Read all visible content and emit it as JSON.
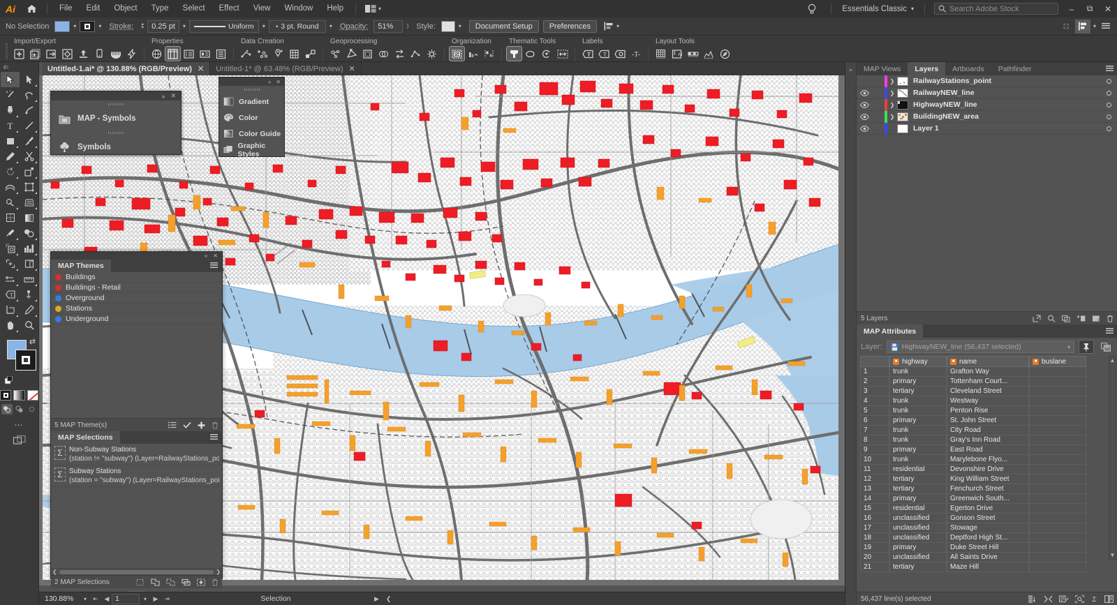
{
  "app": {
    "name": "Adobe Illustrator",
    "logo_text": "Ai",
    "workspace": "Essentials Classic",
    "stock_placeholder": "Search Adobe Stock"
  },
  "menubar": {
    "items": [
      "File",
      "Edit",
      "Object",
      "Type",
      "Select",
      "Effect",
      "View",
      "Window",
      "Help"
    ],
    "home_icon": "home-icon",
    "arrange_icon": "arrange-documents-icon",
    "bulb_icon": "lightbulb-icon",
    "search_icon": "search-icon",
    "window_controls": [
      "minimize",
      "restore",
      "close"
    ]
  },
  "controlbar": {
    "selection_status": "No Selection",
    "fill_label": "fill-swatch",
    "stroke_swatch_label": "stroke-swatch",
    "stroke_label": "Stroke:",
    "stroke_weight": "0.25 pt",
    "profile_label": "Uniform",
    "brush_label": "3 pt. Round",
    "opacity_label": "Opacity:",
    "opacity_value": "51%",
    "style_label": "Style:",
    "document_setup": "Document Setup",
    "preferences": "Preferences",
    "align_icon": "align-icon"
  },
  "maptoolbar": {
    "groups": [
      {
        "title": "Import/Export",
        "icons": [
          "import-icon",
          "import-multiple-icon",
          "export-icon",
          "simple-import-icon",
          "upload-icon",
          "device-icon",
          "web-author-icon",
          "quick-import-icon"
        ]
      },
      {
        "title": "Properties",
        "icons": [
          "map-view-editor-icon",
          "map-attributes-icon",
          "attribute-schema-icon",
          "map-tags-icon",
          "data-list-icon"
        ]
      },
      {
        "title": "Data Creation",
        "icons": [
          "create-line-icon",
          "create-points-icon",
          "create-point-icon",
          "grid-table-icon",
          "join-icon"
        ]
      },
      {
        "title": "Geoprocessing",
        "icons": [
          "dissolve-icon",
          "buffer-icon",
          "clip-icon",
          "spatial-icon",
          "transform-icon",
          "node-editor-icon",
          "settings-icon"
        ]
      },
      {
        "title": "Organization",
        "icons": [
          "map-area-icon",
          "legend-icon",
          "align-layers-icon"
        ]
      },
      {
        "title": "Thematic Tools",
        "icons": [
          "stylesheet-icon",
          "dot-density-icon",
          "scale-bar-theme-icon",
          "range-icon"
        ]
      },
      {
        "title": "Labels",
        "icons": [
          "label-pro-icon",
          "label-icon",
          "label-settings-icon",
          "text-tool-icon"
        ]
      },
      {
        "title": "Layout Tools",
        "icons": [
          "grid-graticule-icon",
          "artboard-icon",
          "scale-bar-icon",
          "elevation-icon",
          "north-arrow-icon"
        ]
      }
    ]
  },
  "tabs": [
    {
      "label": "Untitled-1.ai* @ 130.88% (RGB/Preview)",
      "active": true
    },
    {
      "label": "Untitled-1* @ 63.48% (RGB/Preview)",
      "active": false
    }
  ],
  "toolbox": {
    "tools": [
      [
        "selection-tool",
        "direct-selection-tool"
      ],
      [
        "magic-wand-tool",
        "lasso-tool"
      ],
      [
        "pen-tool",
        "curvature-tool"
      ],
      [
        "type-tool",
        "line-segment-tool"
      ],
      [
        "rectangle-tool",
        "paintbrush-tool"
      ],
      [
        "pencil-tool",
        "scissors-tool"
      ],
      [
        "rotate-tool",
        "scale-tool"
      ],
      [
        "width-tool",
        "free-transform-tool"
      ],
      [
        "shape-builder-tool",
        "perspective-grid-tool"
      ],
      [
        "mesh-tool",
        "gradient-tool"
      ],
      [
        "eyedropper-tool",
        "blend-tool"
      ],
      [
        "symbol-sprayer-tool",
        "column-graph-tool"
      ],
      [
        "artboard-tool",
        "slice-tool"
      ],
      [
        "puppet-warp-tool",
        "measure-tool"
      ],
      [
        "touch-type-tool",
        "anchor-point-tool"
      ],
      [
        "crop-image-tool",
        "pencil-edit-tool"
      ],
      [
        "hand-tool",
        "zoom-tool"
      ]
    ],
    "fill_color": "#8ab4e8",
    "stroke_color": "#1c1c1c",
    "selected_tool": "selection-tool"
  },
  "symbols_panel": {
    "close_icon": "close-icon",
    "expand_icon": "expand-icon",
    "items": [
      {
        "label": "MAP - Symbols",
        "icon": "map-symbols-folder-icon"
      },
      {
        "label": "Symbols",
        "icon": "symbols-clover-icon"
      }
    ]
  },
  "dock_column": {
    "items": [
      {
        "label": "Gradient",
        "icon": "gradient-icon"
      },
      {
        "label": "Color",
        "icon": "color-palette-icon"
      },
      {
        "label": "Color Guide",
        "icon": "color-guide-icon"
      },
      {
        "label": "Graphic Styles",
        "icon": "graphic-styles-icon"
      }
    ]
  },
  "map_themes": {
    "tab_label": "MAP Themes",
    "menu_icon": "panel-menu-icon",
    "items": [
      {
        "label": "Buildings",
        "color": "#e02b2b"
      },
      {
        "label": "Buildings - Retail",
        "color": "#e02b2b"
      },
      {
        "label": "Overground",
        "color": "#2f7fe0"
      },
      {
        "label": "Stations",
        "color": "#e0a81e"
      },
      {
        "label": "Underground",
        "color": "#2f7fe0"
      }
    ],
    "footer_count": "5 MAP Theme(s)",
    "footer_icons": [
      "list-view-icon",
      "apply-theme-icon",
      "new-theme-icon",
      "delete-theme-icon"
    ]
  },
  "map_selections": {
    "tab_label": "MAP Selections",
    "menu_icon": "panel-menu-icon",
    "items": [
      {
        "name": "Non-Subway Stations",
        "expr": "(station != \"subway\") (Layer=RailwayStations_point)"
      },
      {
        "name": "Subway Stations",
        "expr": "(station = \"subway\") (Layer=RailwayStations_point)"
      }
    ],
    "footer_count": "2 MAP Selections",
    "footer_icons": [
      "new-selection-icon",
      "union-icon",
      "subtract-icon",
      "intersect-icon",
      "add-selection-icon",
      "delete-selection-icon"
    ]
  },
  "right_dock": {
    "tabs": [
      {
        "label": "MAP Views",
        "active": false
      },
      {
        "label": "Layers",
        "active": true
      },
      {
        "label": "Artboards",
        "active": false
      },
      {
        "label": "Pathfinder",
        "active": false
      }
    ],
    "menu_icon": "panel-menu-icon",
    "layers": [
      {
        "name": "RailwayStations_point",
        "color": "#ff3ce0",
        "visible": false,
        "has_children": true,
        "thumb": "points-thumb"
      },
      {
        "name": "RailwayNEW_line",
        "color": "#3a49e8",
        "visible": true,
        "has_children": true,
        "thumb": "lines-thumb"
      },
      {
        "name": "HighwayNEW_line",
        "color": "#e8413a",
        "visible": true,
        "has_children": true,
        "thumb": "highway-thumb"
      },
      {
        "name": "BuildingNEW_area",
        "color": "#3ae05a",
        "visible": true,
        "has_children": true,
        "thumb": "buildings-thumb"
      },
      {
        "name": "Layer 1",
        "color": "#3a49e8",
        "visible": true,
        "has_children": false,
        "thumb": "empty-thumb"
      }
    ],
    "layers_footer_count": "5 Layers",
    "layers_footer_icons": [
      "release-icon",
      "locate-icon",
      "make-mask-icon",
      "new-sublayer-icon",
      "new-layer-icon",
      "delete-layer-icon"
    ]
  },
  "map_attributes": {
    "tab_label": "MAP Attributes",
    "menu_icon": "panel-menu-icon",
    "layer_label": "Layer:",
    "layer_value": "HighwayNEW_line (56,437 selected)",
    "layer_icon": "save-layer-icon",
    "pin_icon": "pin-icon",
    "copy_icon": "duplicate-icon",
    "columns": [
      "highway",
      "name",
      "buslane"
    ],
    "rows": [
      {
        "i": "1",
        "highway": "trunk",
        "name": "Grafton Way",
        "buslane": ""
      },
      {
        "i": "2",
        "highway": "primary",
        "name": "Tottenham Court...",
        "buslane": ""
      },
      {
        "i": "3",
        "highway": "tertiary",
        "name": "Cleveland Street",
        "buslane": ""
      },
      {
        "i": "4",
        "highway": "trunk",
        "name": "Westway",
        "buslane": ""
      },
      {
        "i": "5",
        "highway": "trunk",
        "name": "Penton Rise",
        "buslane": ""
      },
      {
        "i": "6",
        "highway": "primary",
        "name": "St. John Street",
        "buslane": ""
      },
      {
        "i": "7",
        "highway": "trunk",
        "name": "City Road",
        "buslane": ""
      },
      {
        "i": "8",
        "highway": "trunk",
        "name": "Gray's Inn Road",
        "buslane": ""
      },
      {
        "i": "9",
        "highway": "primary",
        "name": "East Road",
        "buslane": ""
      },
      {
        "i": "10",
        "highway": "trunk",
        "name": "Marylebone Flyo...",
        "buslane": ""
      },
      {
        "i": "11",
        "highway": "residential",
        "name": "Devonshire Drive",
        "buslane": ""
      },
      {
        "i": "12",
        "highway": "tertiary",
        "name": "King William Street",
        "buslane": ""
      },
      {
        "i": "13",
        "highway": "tertiary",
        "name": "Fenchurch Street",
        "buslane": ""
      },
      {
        "i": "14",
        "highway": "primary",
        "name": "Greenwich South...",
        "buslane": ""
      },
      {
        "i": "15",
        "highway": "residential",
        "name": "Egerton Drive",
        "buslane": ""
      },
      {
        "i": "16",
        "highway": "unclassified",
        "name": "Gonson Street",
        "buslane": ""
      },
      {
        "i": "17",
        "highway": "unclassified",
        "name": "Stowage",
        "buslane": ""
      },
      {
        "i": "18",
        "highway": "unclassified",
        "name": "Deptford High St...",
        "buslane": ""
      },
      {
        "i": "19",
        "highway": "primary",
        "name": "Duke Street Hill",
        "buslane": ""
      },
      {
        "i": "20",
        "highway": "unclassified",
        "name": "All Saints Drive",
        "buslane": ""
      },
      {
        "i": "21",
        "highway": "tertiary",
        "name": "Maze Hill",
        "buslane": ""
      }
    ],
    "footer_count": "56,437 line(s) selected",
    "footer_icons": [
      "columns-icon",
      "collapse-icon",
      "edit-icon",
      "find-icon",
      "stats-icon",
      "copy-table-icon"
    ]
  },
  "statusbar": {
    "zoom": "130.88%",
    "page": "1",
    "tool": "Selection",
    "nav_icons": [
      "first-page-icon",
      "prev-page-icon",
      "next-page-icon",
      "last-page-icon"
    ]
  },
  "map": {
    "water_color": "#a8cbe8",
    "building_fill": "#f2f2f2",
    "highlight_red": "#ee1c24",
    "highlight_orange": "#f5a02a",
    "highlight_yellow": "#f2ee82",
    "road_color": "#6e6e6e",
    "background": "#ffffff"
  }
}
